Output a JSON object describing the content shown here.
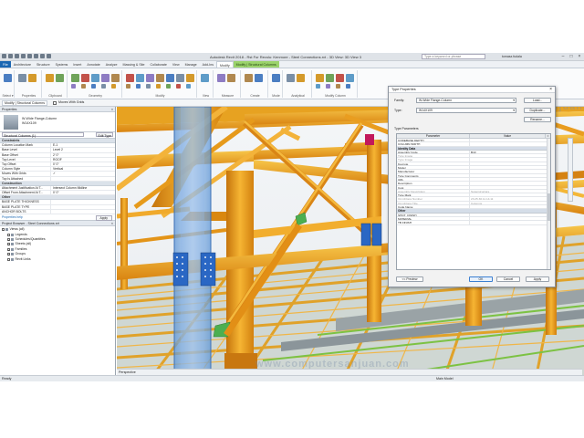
{
  "window": {
    "title": "Autodesk Revit 2018 - Rst For Revolu: Kenmore - Steel Connections.rvt - 3D View: 3D View 3",
    "search_placeholder": "Type a keyword or phrase",
    "user": "tomasz.fudala",
    "min": "–",
    "max": "□",
    "close": "×"
  },
  "tabs": [
    {
      "label": "File",
      "kind": "file"
    },
    {
      "label": "Architecture",
      "kind": ""
    },
    {
      "label": "Structure",
      "kind": ""
    },
    {
      "label": "Systems",
      "kind": ""
    },
    {
      "label": "Insert",
      "kind": ""
    },
    {
      "label": "Annotate",
      "kind": ""
    },
    {
      "label": "Analyze",
      "kind": ""
    },
    {
      "label": "Massing & Site",
      "kind": ""
    },
    {
      "label": "Collaborate",
      "kind": ""
    },
    {
      "label": "View",
      "kind": ""
    },
    {
      "label": "Manage",
      "kind": ""
    },
    {
      "label": "Add-Ins",
      "kind": ""
    },
    {
      "label": "Modify",
      "kind": "active"
    },
    {
      "label": "Modify | Structural Columns",
      "kind": "ctx"
    }
  ],
  "ribbon_groups": [
    {
      "label": "Select ▾",
      "w": 14
    },
    {
      "label": "Properties",
      "w": 28
    },
    {
      "label": "Clipboard",
      "w": 26
    },
    {
      "label": "Geometry",
      "w": 58
    },
    {
      "label": "Modify",
      "w": 80
    },
    {
      "label": "View",
      "w": 16
    },
    {
      "label": "Measure",
      "w": 28
    },
    {
      "label": "Create",
      "w": 28
    },
    {
      "label": "Mode",
      "w": 14
    },
    {
      "label": "Analytical",
      "w": 30
    },
    {
      "label": "Modify Column",
      "w": 48
    }
  ],
  "ribbon_buttons": [
    {
      "label": "Edit Family"
    },
    {
      "label": "Highlight Analytical"
    },
    {
      "label": "Attach Top/Base"
    },
    {
      "label": "Detach Top/Base"
    }
  ],
  "options_bar": {
    "context": "Modify | Structural Columns",
    "checkbox": "Moves With Grids"
  },
  "properties_panel": {
    "title": "Properties",
    "type_name": "W-Wide Flange-Column",
    "type_size": "W14X109",
    "selector": "Structural Columns (1)",
    "edit_type": "Edit Type",
    "sections": [
      {
        "name": "Constraints",
        "rows": [
          [
            "Column Location Mark",
            "E-1"
          ],
          [
            "Base Level",
            "Level 2"
          ],
          [
            "Base Offset",
            "2' 0\""
          ],
          [
            "Top Level",
            "ROOF"
          ],
          [
            "Top Offset",
            "0' 0\""
          ],
          [
            "Column Style",
            "Vertical"
          ],
          [
            "Moves With Grids",
            "✓"
          ],
          [
            "Top Is Attached",
            ""
          ]
        ]
      },
      {
        "name": "Construction",
        "rows": [
          [
            "Attachment Justification At T...",
            "Intersect Column Midline"
          ],
          [
            "Offset From Attachment At T...",
            "0' 0\""
          ]
        ]
      },
      {
        "name": "Other",
        "rows": [
          [
            "BASE PLATE THICKNESS",
            ""
          ],
          [
            "BASE PLATE TYPE",
            ""
          ],
          [
            "ANCHOR BOLTS",
            ""
          ]
        ]
      }
    ],
    "help_link": "Properties help",
    "apply": "Apply"
  },
  "project_browser": {
    "title": "Project Browser - Steel Connections.rvt",
    "items": [
      {
        "label": "Views (all)",
        "toggle": "–"
      },
      {
        "label": "Legends",
        "toggle": ""
      },
      {
        "label": "Schedules/Quantities",
        "toggle": "+"
      },
      {
        "label": "Sheets (all)",
        "toggle": "+"
      },
      {
        "label": "Families",
        "toggle": "+"
      },
      {
        "label": "Groups",
        "toggle": "+"
      },
      {
        "label": "Revit Links",
        "toggle": ""
      }
    ]
  },
  "view_control_bar": {
    "label": "Perspective"
  },
  "status_bar": {
    "left": "Ready",
    "model": "Main Model"
  },
  "type_properties": {
    "title": "Type Properties",
    "close": "×",
    "family_label": "Family:",
    "family_value": "W-Wide Flange-Column",
    "type_label": "Type:",
    "type_value": "W14X109",
    "load_btn": "Load...",
    "duplicate_btn": "Duplicate...",
    "rename_btn": "Rename...",
    "type_params_label": "Type Parameters",
    "col_param": "Parameter",
    "col_value": "Value",
    "col_eq": "=",
    "grid": [
      {
        "kind": "row",
        "name": "CODEBASE DEPTH",
        "value": ""
      },
      {
        "kind": "row",
        "name": "COLUMN WIDTH",
        "value": ""
      },
      {
        "kind": "sec",
        "name": "Identity Data"
      },
      {
        "kind": "row",
        "name": "Assembly Code",
        "value": "B10"
      },
      {
        "kind": "row",
        "name": "Type Image",
        "value": "",
        "dim": true
      },
      {
        "kind": "row",
        "name": "Type Image",
        "value": "",
        "dim": true
      },
      {
        "kind": "row",
        "name": "Keynote",
        "value": ""
      },
      {
        "kind": "row",
        "name": "Model",
        "value": ""
      },
      {
        "kind": "row",
        "name": "Manufacturer",
        "value": ""
      },
      {
        "kind": "row",
        "name": "Type Comments",
        "value": ""
      },
      {
        "kind": "row",
        "name": "URL",
        "value": ""
      },
      {
        "kind": "row",
        "name": "Description",
        "value": ""
      },
      {
        "kind": "row",
        "name": "Cost",
        "value": ""
      },
      {
        "kind": "row",
        "name": "Assembly Description",
        "value": "Superstructure",
        "dim": true
      },
      {
        "kind": "row",
        "name": "Type Mark",
        "value": ""
      },
      {
        "kind": "row",
        "name": "OmniClass Number",
        "value": "23.25.30.11.14.11",
        "dim": true
      },
      {
        "kind": "row",
        "name": "OmniClass Title",
        "value": "Columns",
        "dim": true
      },
      {
        "kind": "row",
        "name": "Code Name",
        "value": ""
      },
      {
        "kind": "sec",
        "name": "Other"
      },
      {
        "kind": "row",
        "name": "SHOT_FINISH",
        "value": ""
      },
      {
        "kind": "row",
        "name": "MATERIAL",
        "value": ""
      },
      {
        "kind": "row",
        "name": "TB FINISH",
        "value": ""
      }
    ],
    "preview_btn": "<< Preview",
    "ok_btn": "OK",
    "cancel_btn": "Cancel",
    "apply_btn": "Apply"
  },
  "watermark": "www.computersanjuan.com",
  "colors": {
    "beam_yellow": "#f2a51c",
    "beam_orange": "#e58914",
    "glass_blue": "#6fa8dc",
    "plate_green": "#4caf50",
    "bolt_blue": "#1f62c2",
    "connection_magenta": "#c2185b"
  }
}
